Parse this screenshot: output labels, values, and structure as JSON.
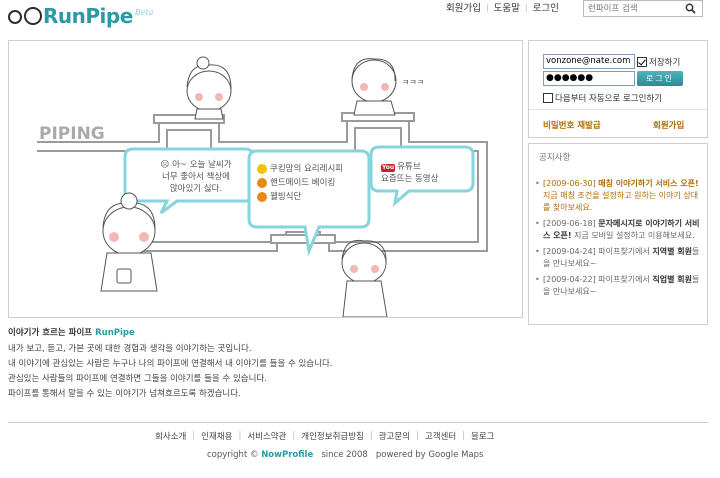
{
  "logo": {
    "text": "RunPipe",
    "beta": "Beta"
  },
  "topnav": {
    "signup": "회원가입",
    "help": "도움말",
    "login": "로그인"
  },
  "search": {
    "placeholder": "런파이프 검색"
  },
  "hero": {
    "piping": "PIPING",
    "laugh": "ㅋㅋㅋ",
    "bubble1": [
      "아~ 오늘 날씨가",
      "너무 좋아서 책상에",
      "앉아있기 싫다."
    ],
    "bubble2": [
      "쿠킹맘의 요리레시피",
      "핸드메이드 베이킹",
      "웰빙식단"
    ],
    "bubble3": {
      "youtube": "You",
      "line1": "유튜브",
      "line2": "요즘뜨는 동영상"
    }
  },
  "login": {
    "email": "vonzone@nate.com",
    "password": "●●●●●●",
    "save_id": "저장하기",
    "button": "로그인",
    "auto_login": "다음부터 자동으로 로그인하기",
    "find_password": "비밀번호 재발급",
    "join": "회원가입"
  },
  "notice": {
    "title": "공지사항",
    "items": [
      {
        "date": "[2009-06-30]",
        "bold": "매칭 이야기하기 서비스 오픈!",
        "rest": " 지금 매칭 조건을 설정하고 원하는 이야기 상대를 찾아보세요."
      },
      {
        "date": "[2009-06-18]",
        "bold": "문자메시지로 이야기하기 서비스 오픈!",
        "rest": " 지금 모바일 설정하고 이용해보세요."
      },
      {
        "date": "[2009-04-24]",
        "pre": " 파이프찾기에서 ",
        "bold": "지역별 회원",
        "rest": "들을 만나보세요~"
      },
      {
        "date": "[2009-04-22]",
        "pre": " 파이프찾기에서 ",
        "bold": "직업별 회원",
        "rest": "들을 만나보세요~"
      }
    ]
  },
  "intro": {
    "title_prefix": "이야기가 흐르는 파이프 ",
    "title_brand": "RunPipe",
    "lines": [
      "내가 보고, 듣고, 가본 곳에 대한 경험과 생각을 이야기하는 곳입니다.",
      "내 이야기에 관심있는 사람은 누구나 나의 파이프에 연결해서 내 이야기를 들을 수 있습니다.",
      "관심있는 사람들의 파이프에 연결하면 그들을 이야기를 들을 수 있습니다.",
      "파이프를 통해서 말을 수 있는 이야기가 넘쳐흐르도록 하겠습니다."
    ]
  },
  "footer": {
    "links": [
      "회사소개",
      "인재채용",
      "서비스약관",
      "개인정보취급방침",
      "광고문의",
      "고객센터",
      "블로그"
    ],
    "copyright_prefix": "copyright ©",
    "brand": "NowProfile",
    "since": "since 2008",
    "powered": "powered by Google Maps"
  },
  "colors": {
    "accent": "#2b9aa6",
    "link_orange": "#b06a00",
    "bubble": "#7fd0d8"
  }
}
